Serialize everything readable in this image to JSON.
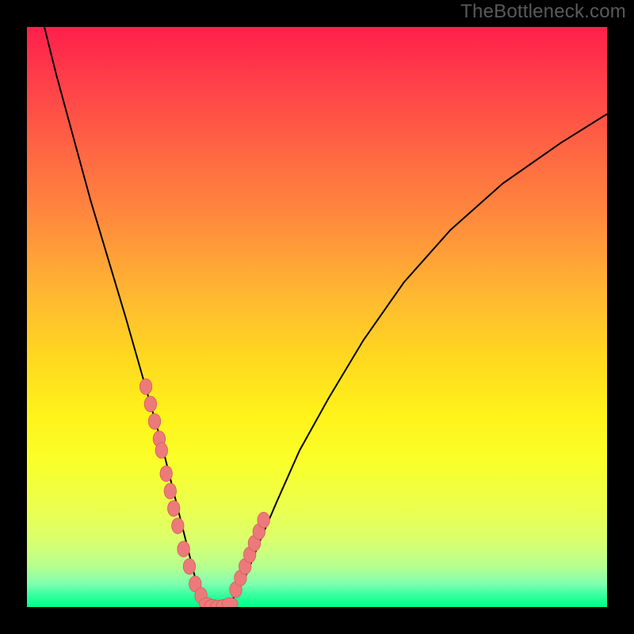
{
  "watermark": "TheBottleneck.com",
  "chart_data": {
    "type": "line",
    "title": "",
    "xlabel": "",
    "ylabel": "",
    "xlim": [
      0,
      100
    ],
    "ylim": [
      0,
      100
    ],
    "curve": {
      "x": [
        3,
        5,
        8,
        11,
        14,
        17,
        19,
        21,
        23,
        24.5,
        26,
        27.5,
        29,
        30.5,
        32,
        34,
        36,
        38,
        40,
        43,
        47,
        52,
        58,
        65,
        73,
        82,
        92,
        100
      ],
      "y": [
        100,
        92,
        81,
        70,
        60,
        50,
        43,
        36,
        29,
        23,
        17,
        11,
        5,
        2,
        0,
        0,
        2,
        6,
        11,
        18,
        27,
        36,
        46,
        56,
        65,
        73,
        80,
        85
      ]
    },
    "markers_left": {
      "x": [
        20.5,
        21.3,
        22.0,
        22.8,
        23.2,
        24.0,
        24.7,
        25.3,
        26.0,
        27.0,
        28.0,
        29.0,
        30.0
      ],
      "y": [
        38,
        35,
        32,
        29,
        27,
        23,
        20,
        17,
        14,
        10,
        7,
        4,
        2
      ]
    },
    "markers_bottom": {
      "x": [
        31.0,
        32.0,
        33.0,
        34.0,
        35.0
      ],
      "y": [
        0.6,
        0.3,
        0.2,
        0.3,
        0.6
      ]
    },
    "markers_right": {
      "x": [
        36.0,
        36.8,
        37.6,
        38.4,
        39.2,
        40.0,
        40.8
      ],
      "y": [
        3,
        5,
        7,
        9,
        11,
        13,
        15
      ]
    },
    "marker_color": "#ed7a7a",
    "marker_outline": "#d46060",
    "curve_color": "#000000"
  }
}
